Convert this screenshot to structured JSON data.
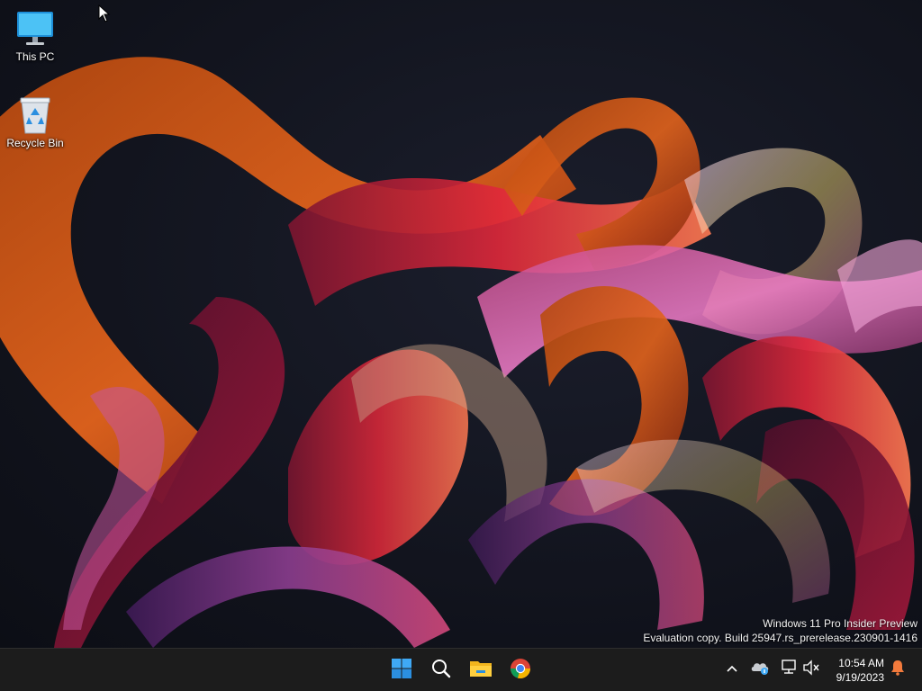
{
  "desktop": {
    "icons": [
      {
        "label": "This PC",
        "icon": "monitor-icon"
      },
      {
        "label": "Recycle Bin",
        "icon": "recycle-bin-icon"
      }
    ],
    "watermark": {
      "line1": "Windows 11 Pro Insider Preview",
      "line2": "Evaluation copy. Build 25947.rs_prerelease.230901-1416"
    }
  },
  "taskbar": {
    "apps": [
      {
        "name": "Start",
        "icon": "windows-logo-icon"
      },
      {
        "name": "Search",
        "icon": "search-icon"
      },
      {
        "name": "File Explorer",
        "icon": "folder-icon"
      },
      {
        "name": "Google Chrome",
        "icon": "chrome-icon"
      }
    ],
    "tray": {
      "icons": [
        "chevron-up-icon",
        "onedrive-icon",
        "network-icon",
        "volume-muted-icon",
        "notification-bell-icon"
      ],
      "time": "10:54 AM",
      "date": "9/19/2023"
    }
  },
  "colors": {
    "taskbar_bg": "#1c1c1c",
    "accent_blue": "#3fa9f5",
    "notification_orange": "#f27a3c"
  }
}
